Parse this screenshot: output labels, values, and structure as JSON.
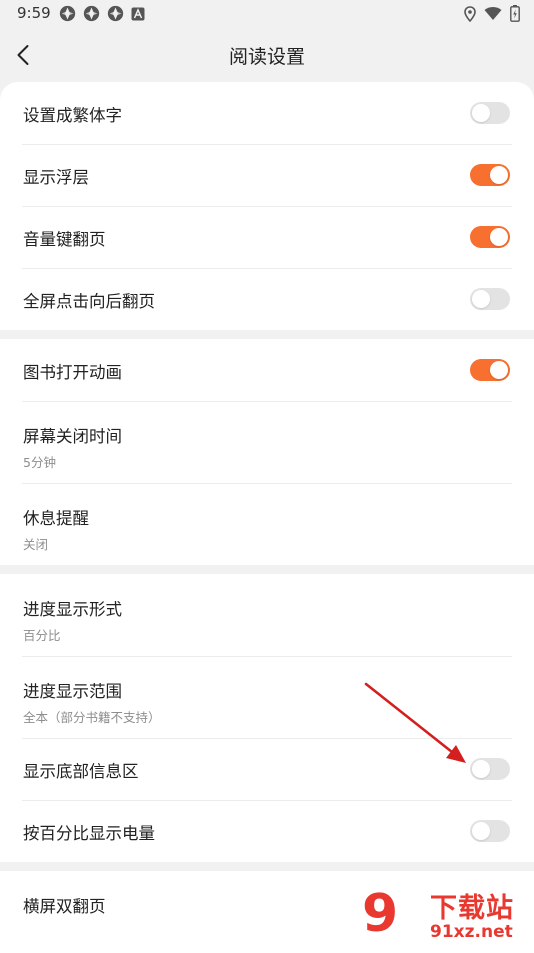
{
  "status_bar": {
    "time": "9:59",
    "left_icons": [
      "app-icon",
      "app-icon",
      "app-icon",
      "a-badge-icon"
    ],
    "right_icons": [
      "location-icon",
      "wifi-icon",
      "battery-icon"
    ]
  },
  "nav": {
    "title": "阅读设置",
    "back_icon": "chevron-left-icon"
  },
  "colors": {
    "accent": "#f7702f",
    "toggle_off": "#e3e3e3",
    "background": "#f1f1f1",
    "watermark": "#e8382f"
  },
  "groups": [
    {
      "items": [
        {
          "label": "设置成繁体字",
          "toggle": false
        },
        {
          "label": "显示浮层",
          "toggle": true
        },
        {
          "label": "音量键翻页",
          "toggle": true
        },
        {
          "label": "全屏点击向后翻页",
          "toggle": false
        }
      ]
    },
    {
      "items": [
        {
          "label": "图书打开动画",
          "toggle": true
        },
        {
          "label": "屏幕关闭时间",
          "sub": "5分钟"
        },
        {
          "label": "休息提醒",
          "sub": "关闭"
        }
      ]
    },
    {
      "items": [
        {
          "label": "进度显示形式",
          "sub": "百分比"
        },
        {
          "label": "进度显示范围",
          "sub": "全本（部分书籍不支持）"
        },
        {
          "label": "显示底部信息区",
          "toggle": false
        },
        {
          "label": "按百分比显示电量",
          "toggle": false
        }
      ]
    },
    {
      "items": [
        {
          "label": "横屏双翻页"
        }
      ]
    }
  ],
  "watermark": {
    "logo": "9",
    "title": "下载站",
    "url": "91xz.net"
  }
}
